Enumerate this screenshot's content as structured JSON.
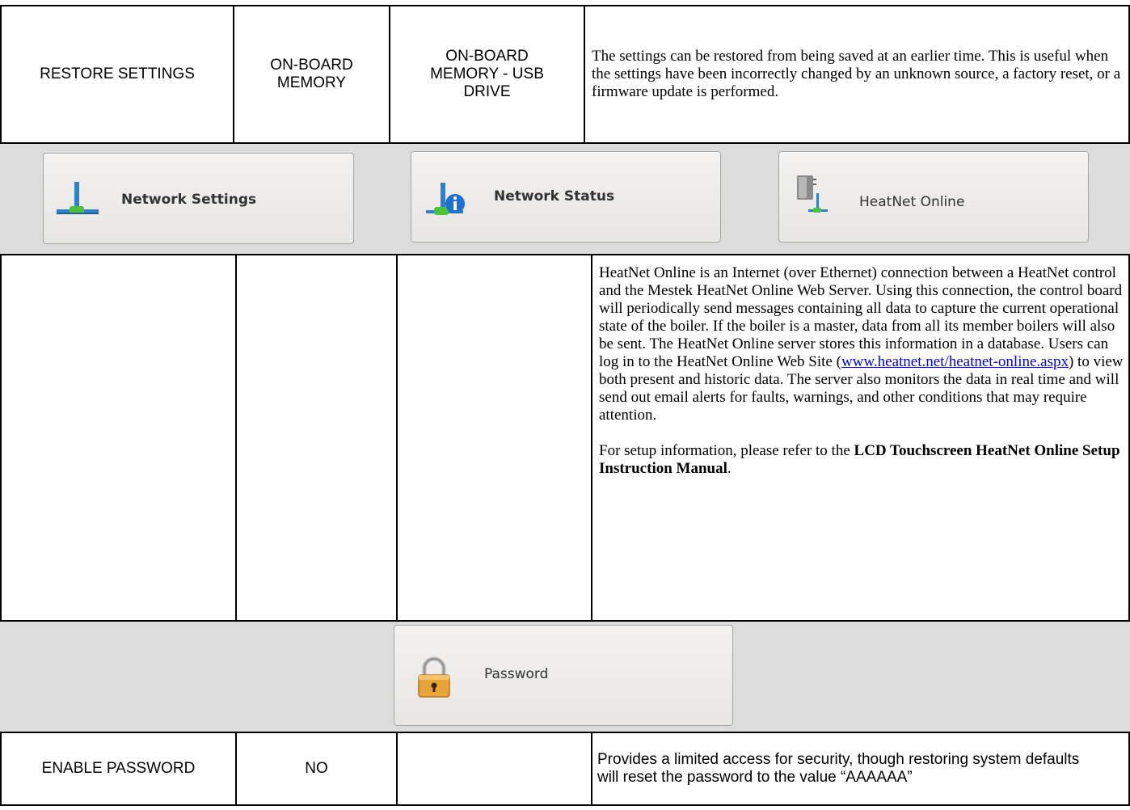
{
  "restore_row": {
    "setting": "RESTORE SETTINGS",
    "default": "ON-BOARD MEMORY",
    "range": "ON-BOARD MEMORY - USB DRIVE",
    "description": "The settings can be restored from being saved at an earlier time. This is useful when the settings have been incorrectly changed by an unknown source, a factory reset, or a firmware update is performed."
  },
  "network_buttons": {
    "network_settings": "Network Settings",
    "network_status": "Network Status",
    "heatnet_online": "HeatNet Online"
  },
  "heatnet_row": {
    "setting": "",
    "default": "",
    "range": "",
    "p1_before_link": "HeatNet Online is an Internet (over Ethernet) connection between a HeatNet control and the Mestek HeatNet Online Web Server. Using this connection, the control board will periodically send messages containing all data to capture the current operational state of the boiler. If the boiler is a master, data from all its member boilers will also be sent. The HeatNet Online server stores this information in a database. Users can log in to the HeatNet Online Web Site (",
    "link": "www.heatnet.net/heatnet-online.aspx",
    "p1_after_link": ") to view both present and historic data. The server also monitors the data in real time and will send out email alerts for faults, warnings, and other conditions that may require attention.",
    "p2_before": "For setup information, please refer to the ",
    "p2_bold": "LCD Touchscreen HeatNet Online Setup Instruction Manual",
    "p2_after": "."
  },
  "password_button": {
    "label": "Password"
  },
  "password_row": {
    "setting": "ENABLE PASSWORD",
    "default": "NO",
    "range": "",
    "description": "Provides a limited access for security, though restoring system defaults will reset the password to the value “AAAAAA”"
  },
  "colors": {
    "band_gray": "#dcdcdc",
    "link_blue": "#0000ee",
    "lock_orange": "#e8a33a",
    "network_green": "#4cc23c",
    "network_blue": "#2f8fd9"
  }
}
